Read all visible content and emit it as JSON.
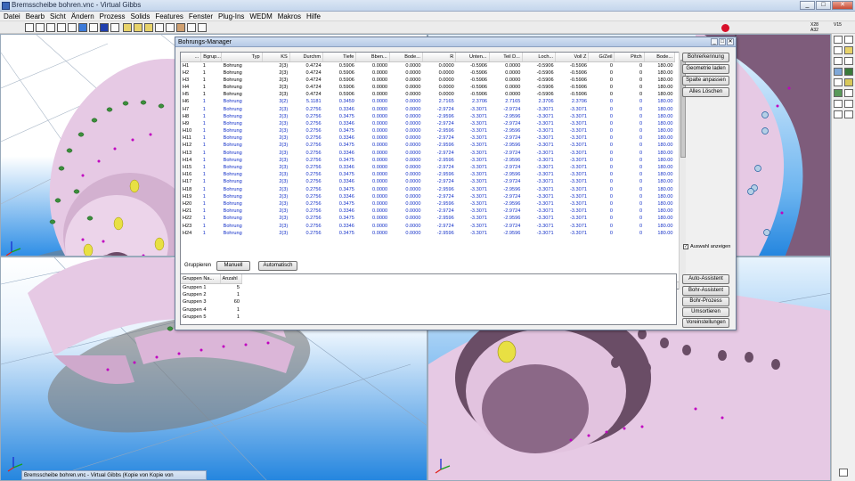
{
  "window": {
    "title": "Bremsscheibe bohren.vnc - Virtual Gibbs",
    "controls": [
      "_",
      "□",
      "✕"
    ]
  },
  "menu": [
    "Datei",
    "Bearb",
    "Sicht",
    "Ändern",
    "Prozess",
    "Solids",
    "Features",
    "Fenster",
    "Plug-Ins",
    "WEDM",
    "Makros",
    "Hilfe"
  ],
  "toolbar": {
    "coords_x_label": "X28",
    "coords_x_val": "V15",
    "coords_y_label": "A32",
    "coords_y_val": ""
  },
  "dialog": {
    "title": "Bohrungs-Manager",
    "columns": [
      "...",
      "Bgrup...",
      "Typ",
      "KS",
      "Durchm",
      "Tiefe",
      "Bben...",
      "Bode...",
      "R",
      "Unten...",
      "Teil D...",
      "Loch...",
      "Voll Z",
      "G/Zeil",
      "Pitch",
      "Bode..."
    ],
    "rows": [
      [
        "H1",
        "1",
        "Bohrung",
        "2(3)",
        "0.4724",
        "0.5906",
        "0.0000",
        "0.0000",
        "0.0000",
        "-0.5906",
        "0.0000",
        "-0.5906",
        "-0.5906",
        "0",
        "0",
        "180.00"
      ],
      [
        "H2",
        "1",
        "Bohrung",
        "2(3)",
        "0.4724",
        "0.5906",
        "0.0000",
        "0.0000",
        "0.0000",
        "-0.5906",
        "0.0000",
        "-0.5906",
        "-0.5906",
        "0",
        "0",
        "180.00"
      ],
      [
        "H3",
        "1",
        "Bohrung",
        "2(3)",
        "0.4724",
        "0.5906",
        "0.0000",
        "0.0000",
        "0.0000",
        "-0.5906",
        "0.0000",
        "-0.5906",
        "-0.5906",
        "0",
        "0",
        "180.00"
      ],
      [
        "H4",
        "1",
        "Bohrung",
        "2(3)",
        "0.4724",
        "0.5906",
        "0.0000",
        "0.0000",
        "0.0000",
        "-0.5906",
        "0.0000",
        "-0.5906",
        "-0.5906",
        "0",
        "0",
        "180.00"
      ],
      [
        "H5",
        "1",
        "Bohrung",
        "2(3)",
        "0.4724",
        "0.5906",
        "0.0000",
        "0.0000",
        "0.0000",
        "-0.5906",
        "0.0000",
        "-0.5906",
        "-0.5906",
        "0",
        "0",
        "180.00"
      ],
      [
        "H6",
        "1",
        "Bohrung",
        "3(2)",
        "5.1181",
        "0.3459",
        "0.0000",
        "0.0000",
        "2.7165",
        "2.3706",
        "2.7165",
        "2.3706",
        "2.3706",
        "0",
        "0",
        "180.00"
      ],
      [
        "H7",
        "1",
        "Bohrung",
        "2(3)",
        "0.2756",
        "0.3346",
        "0.0000",
        "0.0000",
        "-2.9724",
        "-3.3071",
        "-2.9724",
        "-3.3071",
        "-3.3071",
        "0",
        "0",
        "180.00"
      ],
      [
        "H8",
        "1",
        "Bohrung",
        "2(3)",
        "0.2756",
        "0.3475",
        "0.0000",
        "0.0000",
        "-2.9596",
        "-3.3071",
        "-2.9596",
        "-3.3071",
        "-3.3071",
        "0",
        "0",
        "180.00"
      ],
      [
        "H9",
        "1",
        "Bohrung",
        "2(3)",
        "0.2756",
        "0.3346",
        "0.0000",
        "0.0000",
        "-2.9724",
        "-3.3071",
        "-2.9724",
        "-3.3071",
        "-3.3071",
        "0",
        "0",
        "180.00"
      ],
      [
        "H10",
        "1",
        "Bohrung",
        "2(3)",
        "0.2756",
        "0.3475",
        "0.0000",
        "0.0000",
        "-2.9596",
        "-3.3071",
        "-2.9596",
        "-3.3071",
        "-3.3071",
        "0",
        "0",
        "180.00"
      ],
      [
        "H11",
        "1",
        "Bohrung",
        "2(3)",
        "0.2756",
        "0.3346",
        "0.0000",
        "0.0000",
        "-2.9724",
        "-3.3071",
        "-2.9724",
        "-3.3071",
        "-3.3071",
        "0",
        "0",
        "180.00"
      ],
      [
        "H12",
        "1",
        "Bohrung",
        "2(3)",
        "0.2756",
        "0.3475",
        "0.0000",
        "0.0000",
        "-2.9596",
        "-3.3071",
        "-2.9596",
        "-3.3071",
        "-3.3071",
        "0",
        "0",
        "180.00"
      ],
      [
        "H13",
        "1",
        "Bohrung",
        "2(3)",
        "0.2756",
        "0.3346",
        "0.0000",
        "0.0000",
        "-2.9724",
        "-3.3071",
        "-2.9724",
        "-3.3071",
        "-3.3071",
        "0",
        "0",
        "180.00"
      ],
      [
        "H14",
        "1",
        "Bohrung",
        "2(3)",
        "0.2756",
        "0.3475",
        "0.0000",
        "0.0000",
        "-2.9596",
        "-3.3071",
        "-2.9596",
        "-3.3071",
        "-3.3071",
        "0",
        "0",
        "180.00"
      ],
      [
        "H15",
        "1",
        "Bohrung",
        "2(3)",
        "0.2756",
        "0.3346",
        "0.0000",
        "0.0000",
        "-2.9724",
        "-3.3071",
        "-2.9724",
        "-3.3071",
        "-3.3071",
        "0",
        "0",
        "180.00"
      ],
      [
        "H16",
        "1",
        "Bohrung",
        "2(3)",
        "0.2756",
        "0.3475",
        "0.0000",
        "0.0000",
        "-2.9596",
        "-3.3071",
        "-2.9596",
        "-3.3071",
        "-3.3071",
        "0",
        "0",
        "180.00"
      ],
      [
        "H17",
        "1",
        "Bohrung",
        "2(3)",
        "0.2756",
        "0.3346",
        "0.0000",
        "0.0000",
        "-2.9724",
        "-3.3071",
        "-2.9724",
        "-3.3071",
        "-3.3071",
        "0",
        "0",
        "180.00"
      ],
      [
        "H18",
        "1",
        "Bohrung",
        "2(3)",
        "0.2756",
        "0.3475",
        "0.0000",
        "0.0000",
        "-2.9596",
        "-3.3071",
        "-2.9596",
        "-3.3071",
        "-3.3071",
        "0",
        "0",
        "180.00"
      ],
      [
        "H19",
        "1",
        "Bohrung",
        "2(3)",
        "0.2756",
        "0.3346",
        "0.0000",
        "0.0000",
        "-2.9724",
        "-3.3071",
        "-2.9724",
        "-3.3071",
        "-3.3071",
        "0",
        "0",
        "180.00"
      ],
      [
        "H20",
        "1",
        "Bohrung",
        "2(3)",
        "0.2756",
        "0.3475",
        "0.0000",
        "0.0000",
        "-2.9596",
        "-3.3071",
        "-2.9596",
        "-3.3071",
        "-3.3071",
        "0",
        "0",
        "180.00"
      ],
      [
        "H21",
        "1",
        "Bohrung",
        "2(3)",
        "0.2756",
        "0.3346",
        "0.0000",
        "0.0000",
        "-2.9724",
        "-3.3071",
        "-2.9724",
        "-3.3071",
        "-3.3071",
        "0",
        "0",
        "180.00"
      ],
      [
        "H22",
        "1",
        "Bohrung",
        "2(3)",
        "0.2756",
        "0.3475",
        "0.0000",
        "0.0000",
        "-2.9596",
        "-3.3071",
        "-2.9596",
        "-3.3071",
        "-3.3071",
        "0",
        "0",
        "180.00"
      ],
      [
        "H23",
        "1",
        "Bohrung",
        "2(3)",
        "0.2756",
        "0.3346",
        "0.0000",
        "0.0000",
        "-2.9724",
        "-3.3071",
        "-2.9724",
        "-3.3071",
        "-3.3071",
        "0",
        "0",
        "180.00"
      ],
      [
        "H24",
        "1",
        "Bohrung",
        "2(3)",
        "0.2756",
        "0.3475",
        "0.0000",
        "0.0000",
        "-2.9596",
        "-3.3071",
        "-2.9596",
        "-3.3071",
        "-3.3071",
        "0",
        "0",
        "180.00"
      ]
    ],
    "right_buttons": [
      "Bohrerkennung",
      "Geometrie laden",
      "Spalte anpassen",
      "Alles Löschen"
    ],
    "show_selection_label": "Auswahl anzeigen",
    "show_selection_checked": true,
    "group_label": "Gruppieren",
    "group_buttons": [
      "Manuell",
      "Automatisch"
    ],
    "group_columns": [
      "Gruppen Na...",
      "Anzahl"
    ],
    "groups": [
      [
        "Gruppen 1",
        "5"
      ],
      [
        "Gruppen 2",
        "1"
      ],
      [
        "Gruppen 3",
        "60"
      ],
      [
        "Gruppen 4",
        "1"
      ],
      [
        "Gruppen 5",
        "1"
      ]
    ],
    "assist_buttons": [
      "Auto-Assistent",
      "Bohr-Assistent",
      "Bohr-Prozess",
      "Umsortieren",
      "Voreinstellungen"
    ]
  },
  "taskbar": {
    "label": "Bremsscheibe bohren.vnc - Virtual Gibbs (Kopie von Kopie von"
  },
  "colors": {
    "part": "#e4c5e2",
    "viewport_blue": "#2586df",
    "hole": "#3a9b3a",
    "marker": "#c000c0",
    "blue_rows": "#1431c8"
  }
}
